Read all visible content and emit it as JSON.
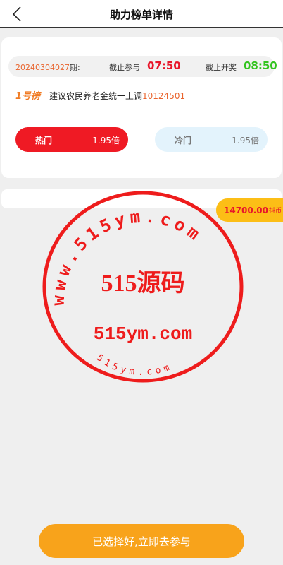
{
  "header": {
    "title": "助力榜单详情",
    "back_icon": "chevron-left-icon"
  },
  "period": {
    "number": "20240304027",
    "suffix": "期:",
    "deadline_label": "截止参与",
    "deadline_time": "07:50",
    "draw_label": "截止开奖",
    "draw_time": "08:50"
  },
  "rank": {
    "tag": "1号榜",
    "text": "建议农民养老金统一上调",
    "code": "10124501"
  },
  "options": [
    {
      "label": "热门",
      "odds": "1.95倍"
    },
    {
      "label": "冷门",
      "odds": "1.95倍"
    }
  ],
  "coins": {
    "amount": "14700.00",
    "unit": "抖币"
  },
  "watermark": {
    "arc_top": "www.515ym.com",
    "center": "515源码",
    "url": "515ym.com",
    "arc_bottom": "515ym.com"
  },
  "cta": {
    "label": "已选择好,立即去参与"
  },
  "colors": {
    "accent_red": "#ef1a24",
    "accent_orange": "#f8a31b",
    "accent_green": "#33c41f",
    "badge_yellow": "#fcbe16"
  }
}
